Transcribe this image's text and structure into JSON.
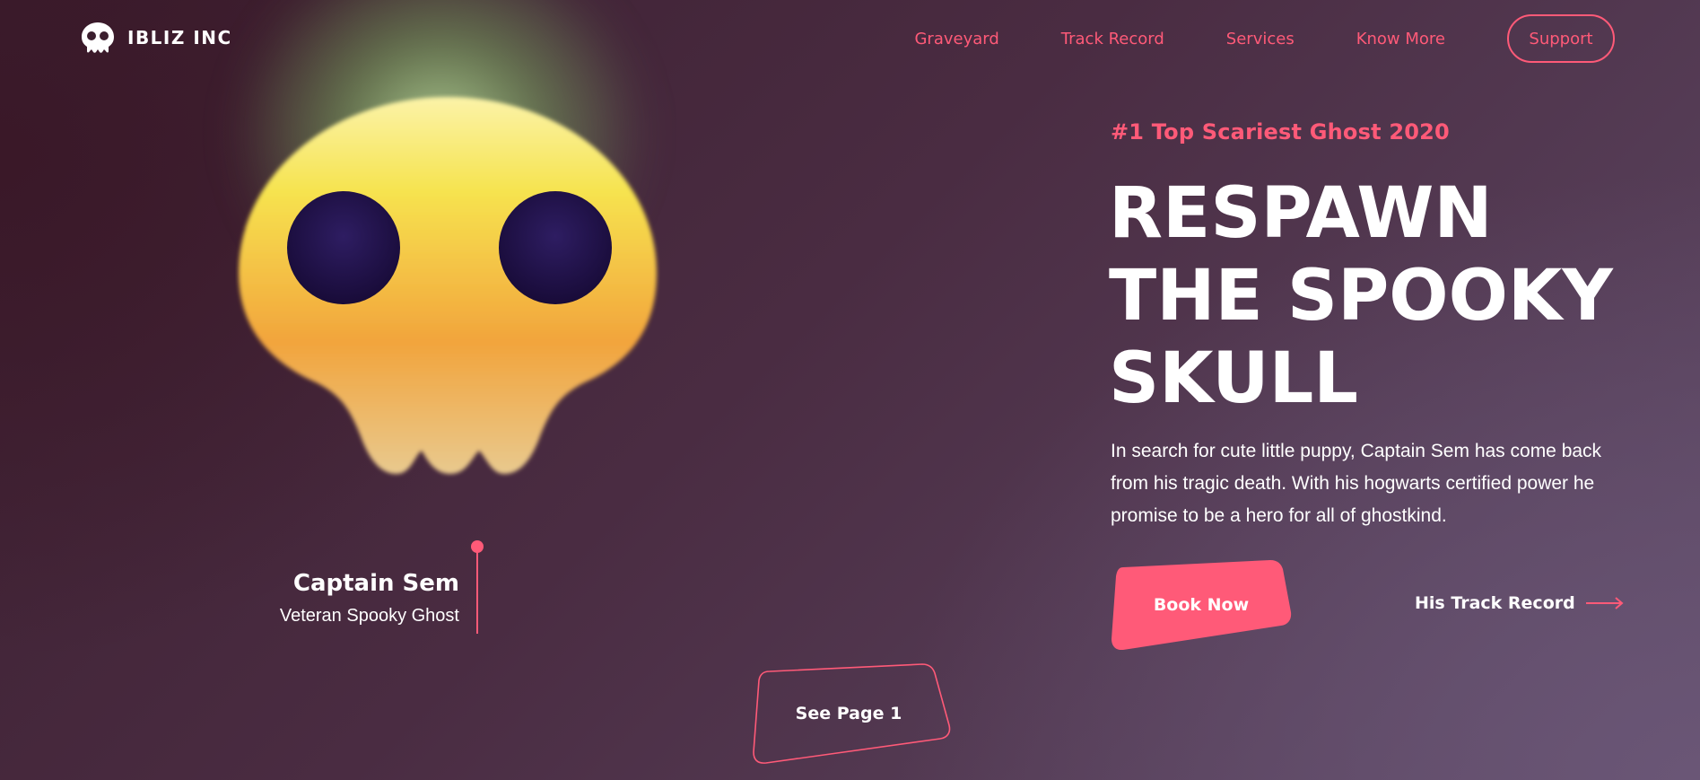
{
  "brand": {
    "name": "IBLIZ INC",
    "icon": "skull-icon"
  },
  "nav": {
    "links": [
      "Graveyard",
      "Track Record",
      "Services",
      "Know More"
    ],
    "support_label": "Support"
  },
  "hero": {
    "badge": "#1 Top Scariest Ghost 2020",
    "title_lines": [
      "RESPAWN",
      "THE SPOOKY",
      "SKULL"
    ],
    "description": "In search for cute little puppy, Captain Sem has come back from his tragic death. With his hogwarts certified power he promise to be a hero for all of ghostkind.",
    "book_label": "Book Now",
    "track_label": "His Track Record"
  },
  "character": {
    "name": "Captain Sem",
    "role": "Veteran Spooky Ghost"
  },
  "pager": {
    "label": "See Page 1"
  },
  "colors": {
    "accent": "#ff5a78",
    "eye": "#22134a",
    "skull_top": "#f7e95a",
    "skull_bottom": "#f08a36"
  }
}
